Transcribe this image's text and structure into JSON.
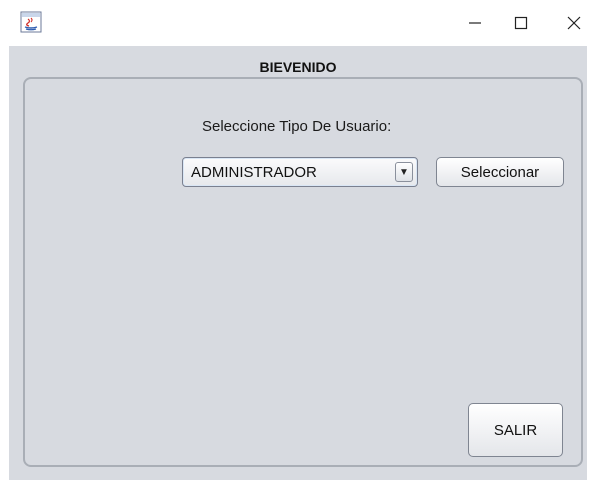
{
  "window": {
    "controls": {
      "minimize_icon": "minimize-icon",
      "maximize_icon": "maximize-icon",
      "close_icon": "close-icon"
    }
  },
  "panel": {
    "title": "BIEVENIDO",
    "prompt": "Seleccione Tipo De Usuario:",
    "user_type": {
      "selected": "ADMINISTRADOR"
    },
    "select_button": "Seleccionar",
    "exit_button": "SALIR"
  }
}
